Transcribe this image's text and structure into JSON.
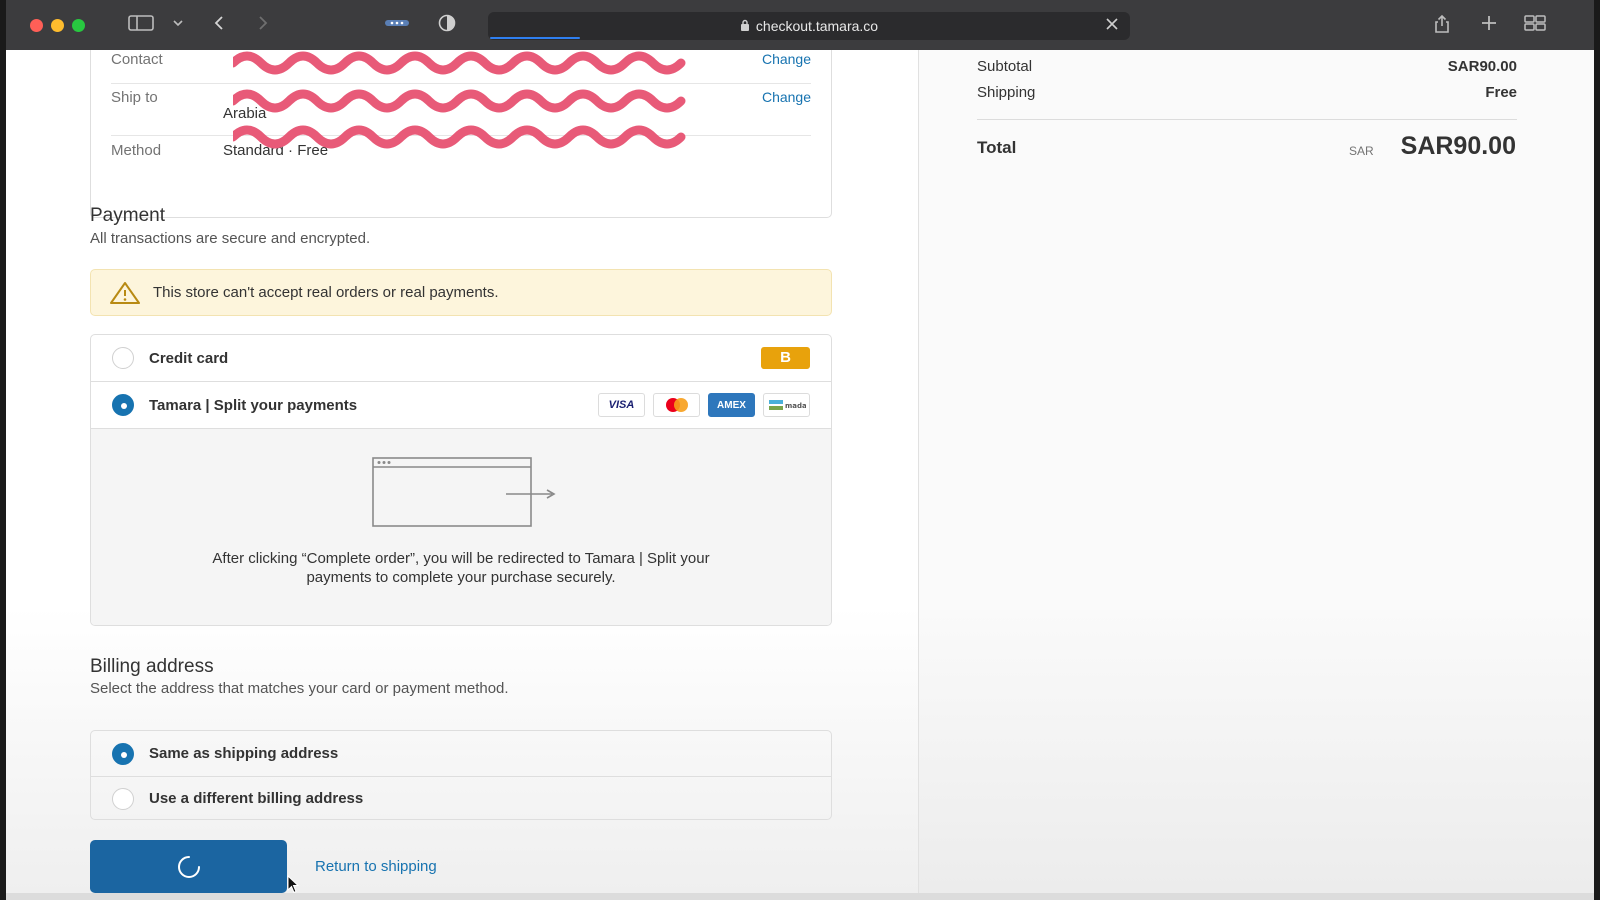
{
  "browser": {
    "url": "checkout.tamara.co",
    "icons": [
      "sidebar-icon",
      "chevron-down-icon",
      "back-icon",
      "forward-icon",
      "extensions-icon",
      "shield-icon",
      "lock-icon",
      "close-icon",
      "share-icon",
      "new-tab-icon",
      "tab-overview-icon"
    ]
  },
  "review": {
    "contact_label": "Contact",
    "ship_to_label": "Ship to",
    "ship_to_value_line2": "Arabia",
    "method_label": "Method",
    "method_value": "Standard · Free",
    "change_label": "Change"
  },
  "payment": {
    "title": "Payment",
    "subtitle": "All transactions are secure and encrypted.",
    "warning": "This store can't accept real orders or real payments.",
    "options": [
      {
        "label": "Credit card",
        "selected": false,
        "badge": "B"
      },
      {
        "label": "Tamara | Split your payments",
        "selected": true,
        "cards": [
          "VISA",
          "mastercard",
          "AMEX",
          "mada"
        ]
      }
    ],
    "redirect_text": "After clicking “Complete order”, you will be redirected to Tamara | Split your payments to complete your purchase securely."
  },
  "billing": {
    "title": "Billing address",
    "subtitle": "Select the address that matches your card or payment method.",
    "options": [
      {
        "label": "Same as shipping address",
        "selected": true
      },
      {
        "label": "Use a different billing address",
        "selected": false
      }
    ]
  },
  "actions": {
    "return_link": "Return to shipping"
  },
  "summary": {
    "subtotal_label": "Subtotal",
    "subtotal_value": "SAR90.00",
    "shipping_label": "Shipping",
    "shipping_value": "Free",
    "total_label": "Total",
    "total_currency": "SAR",
    "total_value": "SAR90.00"
  },
  "colors": {
    "accent": "#1773b0",
    "button": "#1b65a1",
    "warning_bg": "#fdf5dc",
    "badge": "#e8a20c",
    "redaction": "#e85a78"
  }
}
